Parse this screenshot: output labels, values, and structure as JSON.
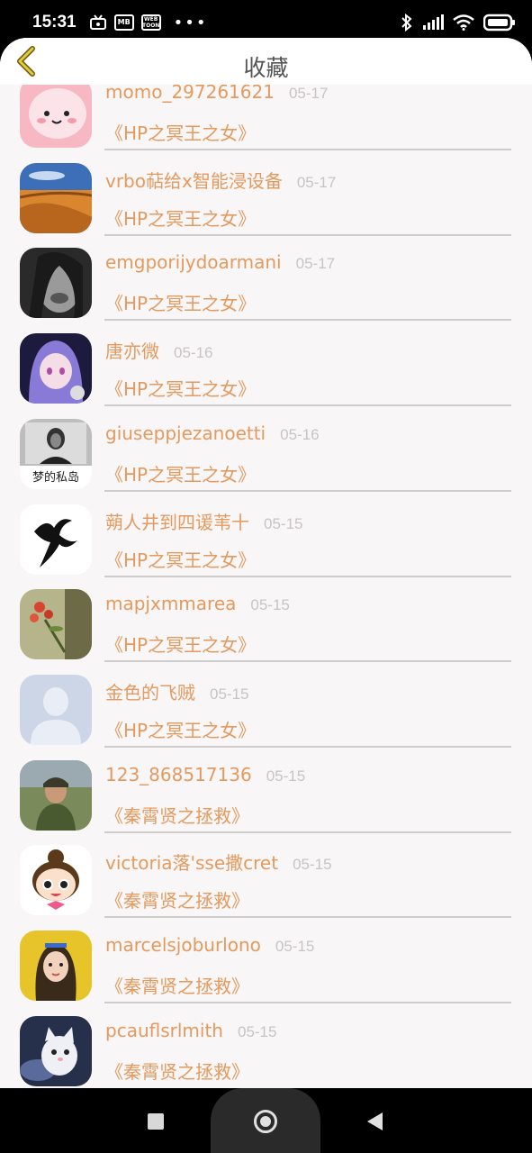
{
  "status_bar": {
    "time": "15:31",
    "left_icons": [
      "tv-icon",
      "mb-badge",
      "webtoon-badge"
    ],
    "badge_mb": "MB",
    "badge_webtoon": "WEB TOON",
    "dots": "•••",
    "right_icons": [
      "bluetooth-icon",
      "signal-icon",
      "wifi-icon",
      "battery-icon"
    ]
  },
  "header": {
    "title": "收藏",
    "back_icon": "chevron-left-icon"
  },
  "colors": {
    "accent": "#e49a5f",
    "date_gray": "#c8c4c4",
    "background": "#f8f6f6",
    "title": "#555555"
  },
  "items": [
    {
      "username": "momo_297261621",
      "date": "05-17",
      "book": "《HP之冥王之女》",
      "avatar": "pink-cartoon-avatar"
    },
    {
      "username": "vrbo萜给x智能浸设备",
      "date": "05-17",
      "book": "《HP之冥王之女》",
      "avatar": "desert-photo-avatar"
    },
    {
      "username": "emgporijydoarmani",
      "date": "05-17",
      "book": "《HP之冥王之女》",
      "avatar": "bw-portrait-avatar"
    },
    {
      "username": "唐亦微",
      "date": "05-16",
      "book": "《HP之冥王之女》",
      "avatar": "anime-girl-avatar"
    },
    {
      "username": "giuseppjezanoetti",
      "date": "05-16",
      "book": "《HP之冥王之女》",
      "avatar": "vintage-photo-avatar",
      "avatar_caption": "梦的私岛"
    },
    {
      "username": "蒴人井到四谖苇十",
      "date": "05-15",
      "book": "《HP之冥王之女》",
      "avatar": "dancer-silhouette-avatar"
    },
    {
      "username": "mapjxmmarea",
      "date": "05-15",
      "book": "《HP之冥王之女》",
      "avatar": "flower-photo-avatar"
    },
    {
      "username": "金色的飞贼",
      "date": "05-15",
      "book": "《HP之冥王之女》",
      "avatar": "default-user-avatar"
    },
    {
      "username": "123_868517136",
      "date": "05-15",
      "book": "《秦霄贤之拯救》",
      "avatar": "game-soldier-avatar"
    },
    {
      "username": "victoria落'sse撒cret",
      "date": "05-15",
      "book": "《秦霄贤之拯救》",
      "avatar": "cartoon-girl-avatar"
    },
    {
      "username": "marcelsjoburlono",
      "date": "05-15",
      "book": "《秦霄贤之拯救》",
      "avatar": "girl-photo-avatar"
    },
    {
      "username": "pcauflsrlmith",
      "date": "05-15",
      "book": "《秦霄贤之拯救》",
      "avatar": "white-cat-avatar"
    }
  ],
  "nav_bar": {
    "icons": [
      "recents-square-icon",
      "home-circle-icon",
      "back-triangle-icon"
    ]
  }
}
